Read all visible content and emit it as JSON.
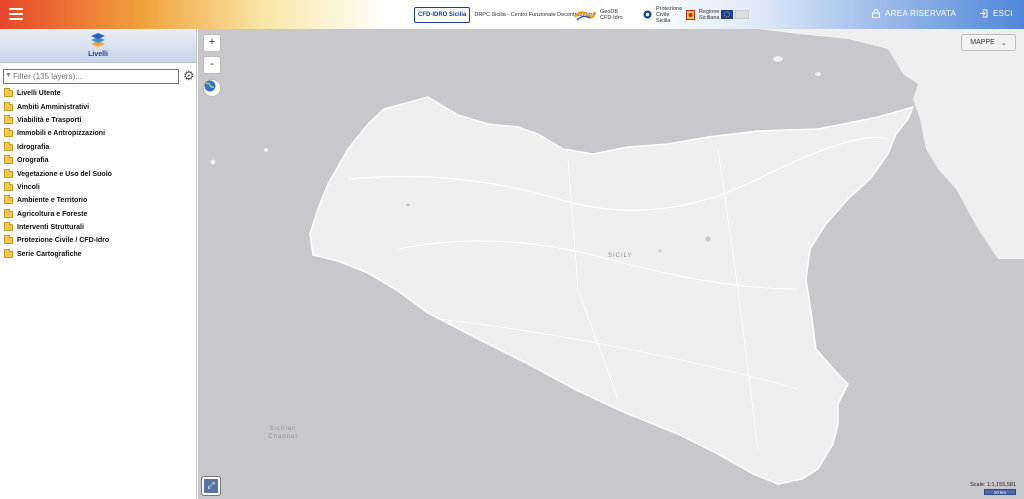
{
  "header": {
    "logos": {
      "cfd_badge": "CFD-IDRO Sicilia",
      "drpc_text": "DRPC Sicilia - Centro Funzionale Decentrato-Idro",
      "geodb_text": "GeoDB CFD-Idro",
      "protezione_text": "Protezione Civile Sicilia",
      "regione_text": "Regione Siciliana"
    },
    "area_riservata": "AREA RISERVATA",
    "esci": "ESCI"
  },
  "sidebar": {
    "title": "Livelli",
    "filter_placeholder": "Filter (135 layers)...",
    "layers": [
      "Livelli Utente",
      "Ambiti Amministrativi",
      "Viabilità e Trasporti",
      "Immobili e Antropizzazioni",
      "Idrografia",
      "Orografia",
      "Vegetazione e Uso del Suolo",
      "Vincoli",
      "Ambiente e Territorio",
      "Agricoltura e Foreste",
      "Interventi Strutturali",
      "Protezione Civile / CFD-Idro",
      "Serie Cartografiche"
    ]
  },
  "map": {
    "zoom_in": "+",
    "zoom_out": "-",
    "mappe_label": "MAPPE",
    "label_sicily": "SICILY",
    "label_channel": "Sicilian Channel",
    "scale_text": "Scale: 1:1,155,581",
    "scalebar_text": "20 km",
    "colors": {
      "sea": "#c7c7cc",
      "land": "#efefef"
    }
  }
}
